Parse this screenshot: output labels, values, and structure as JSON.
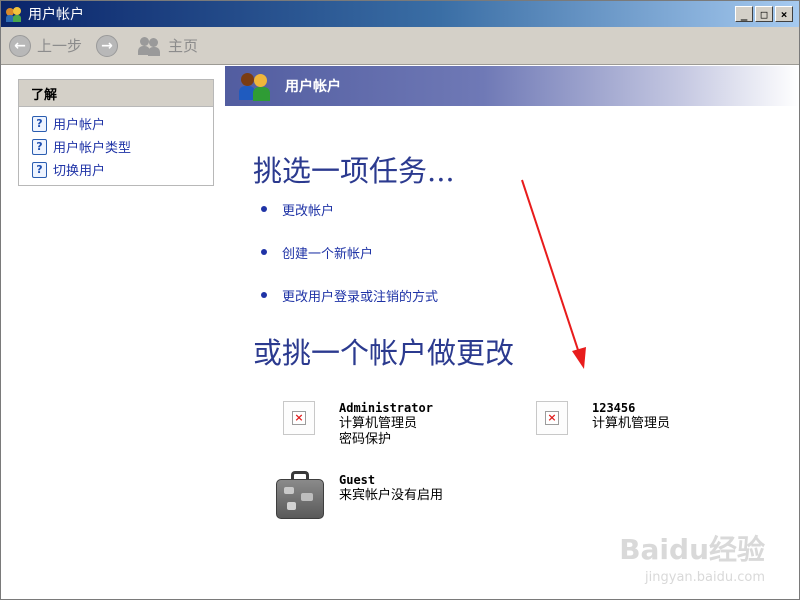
{
  "window": {
    "title": "用户帐户",
    "controls": {
      "minimize": "_",
      "maximize": "□",
      "close": "×"
    }
  },
  "toolbar": {
    "back_label": "上一步",
    "home_label": "主页"
  },
  "sidebar": {
    "heading": "了解",
    "items": [
      {
        "label": "用户帐户",
        "icon": "help-icon"
      },
      {
        "label": "用户帐户类型",
        "icon": "help-icon"
      },
      {
        "label": "切换用户",
        "icon": "help-icon"
      }
    ]
  },
  "banner": {
    "title": "用户帐户"
  },
  "tasks": {
    "heading": "挑选一项任务...",
    "items": [
      {
        "label": "更改帐户"
      },
      {
        "label": "创建一个新帐户"
      },
      {
        "label": "更改用户登录或注销的方式"
      }
    ]
  },
  "accounts": {
    "heading": "或挑一个帐户做更改",
    "list": [
      {
        "name": "Administrator",
        "line1": "计算机管理员",
        "line2": "密码保护",
        "picture": "broken-image-icon"
      },
      {
        "name": "123456",
        "line1": "计算机管理员",
        "line2": "",
        "picture": "broken-image-icon"
      },
      {
        "name": "Guest",
        "line1": "来宾帐户没有启用",
        "line2": "",
        "picture": "suitcase-icon"
      }
    ]
  },
  "watermark": {
    "main": "Baidu经验",
    "sub": "jingyan.baidu.com"
  },
  "colors": {
    "link": "#1f33a6",
    "heading": "#2b3a8f",
    "annotation_arrow": "#e81c1c"
  }
}
